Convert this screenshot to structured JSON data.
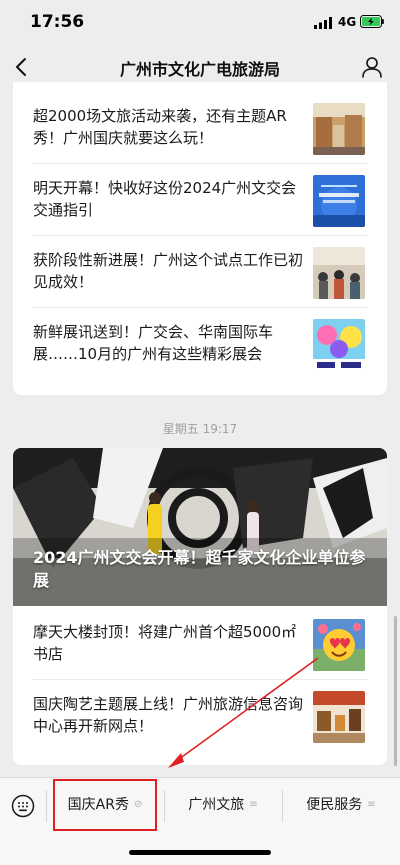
{
  "status_bar": {
    "time": "17:56",
    "network": "4G"
  },
  "nav": {
    "title": "广州市文化广电旅游局"
  },
  "articles_group1": [
    {
      "title": "超2000场文旅活动来袭，还有主题AR秀！广州国庆就要这么玩！",
      "thumb": "lingnan-street-thumbnail"
    },
    {
      "title": "明天开幕！快收好这份2024广州文交会交通指引",
      "thumb": "expo-poster-thumbnail"
    },
    {
      "title": "获阶段性新进展！广州这个试点工作已初见成效！",
      "thumb": "crowd-venue-thumbnail"
    },
    {
      "title": "新鲜展讯送到！广交会、华南国际车展……10月的广州有这些精彩展会",
      "thumb": "cicf-agf-poster-thumbnail"
    }
  ],
  "timestamp": "星期五 19:17",
  "articles_group2": {
    "cover_title": "2024广州文交会开幕！超千家文化企业单位参展",
    "items": [
      {
        "title": "摩天大楼封顶！将建广州首个超5000㎡书店",
        "thumb": "heart-eyes-emoji-thumbnail"
      },
      {
        "title": "国庆陶艺主题展上线！广州旅游信息咨询中心再开新网点！",
        "thumb": "pottery-exhibit-thumbnail"
      }
    ]
  },
  "menu": {
    "items": [
      {
        "label": "国庆AR秀",
        "icon": "link-icon"
      },
      {
        "label": "广州文旅",
        "icon": "menu-lines-icon"
      },
      {
        "label": "便民服务",
        "icon": "menu-lines-icon"
      }
    ]
  },
  "colors": {
    "highlight": "#e02020",
    "background": "#ededed",
    "card": "#ffffff",
    "timestamp": "#a0a0a0"
  }
}
